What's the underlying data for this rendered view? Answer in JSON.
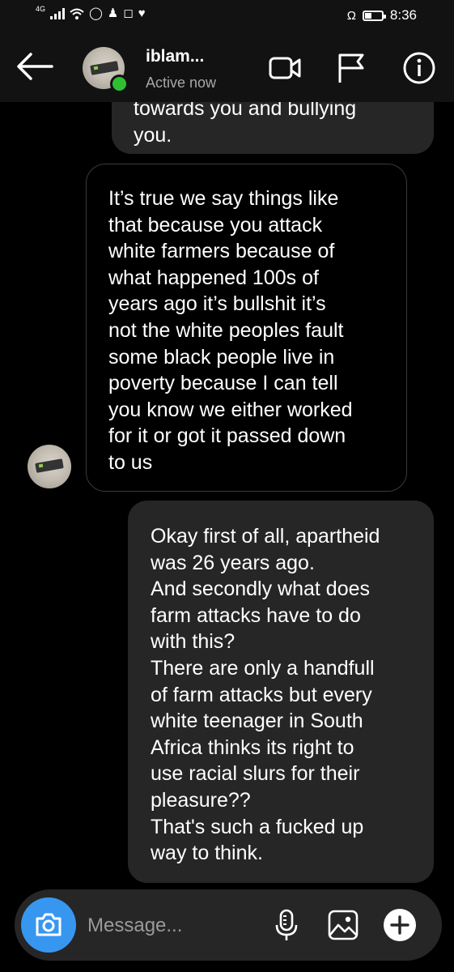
{
  "status_bar": {
    "network": "4G",
    "time": "8:36"
  },
  "header": {
    "name": "iblam...",
    "status": "Active now",
    "online_color": "#2fbf32"
  },
  "messages": [
    {
      "sender": "me",
      "text": "towards you and bullying\nyou."
    },
    {
      "sender": "them",
      "text": "It’s true we say things like\nthat because you attack\nwhite farmers because of\nwhat happened 100s of\nyears ago it’s bullshit it’s\nnot the white peoples fault\nsome black people live in\npoverty because I can tell\nyou know we either worked\nfor it or got it passed down\nto us"
    },
    {
      "sender": "me",
      "text": "Okay first of all, apartheid\nwas 26 years ago.\nAnd secondly what does\nfarm attacks have to do\nwith this?\nThere are only a handfull\nof farm attacks but every\nwhite teenager in South\nAfrica thinks its right to\nuse racial slurs for their\npleasure??\nThat's such a fucked up\nway to think."
    }
  ],
  "composer": {
    "placeholder": "Message...",
    "accent": "#3797f0"
  },
  "icons": {
    "header": [
      "back-arrow-icon",
      "video-call-icon",
      "flag-icon",
      "info-icon"
    ],
    "composer": [
      "camera-icon",
      "microphone-icon",
      "gallery-icon",
      "add-icon"
    ]
  }
}
